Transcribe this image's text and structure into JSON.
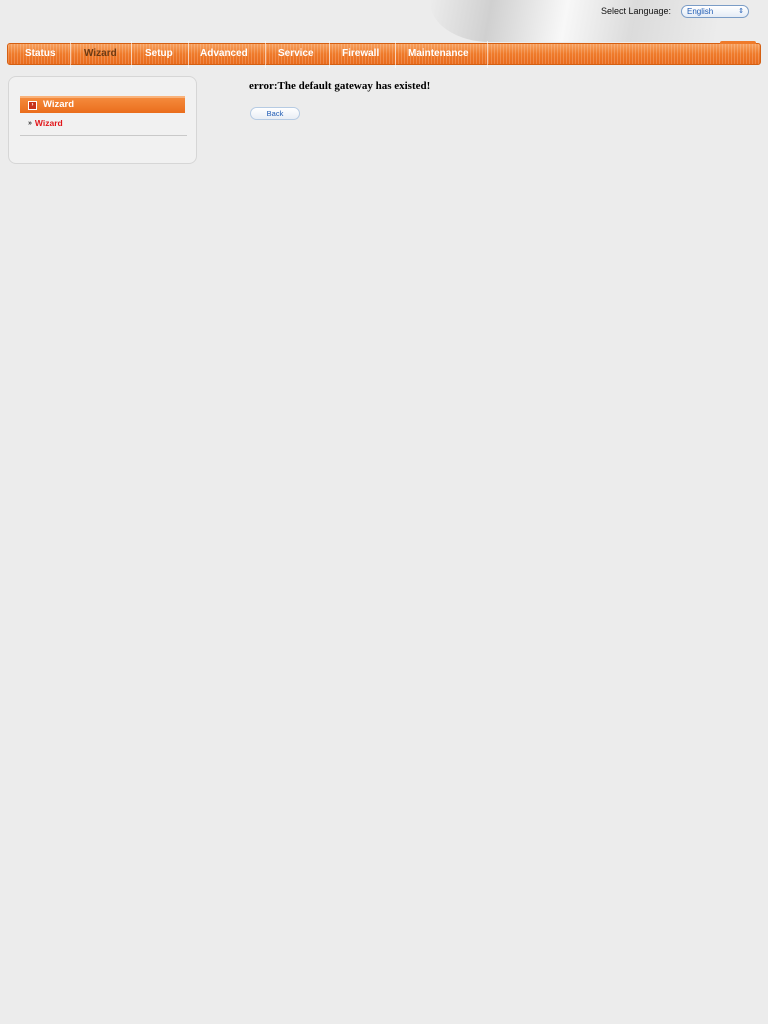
{
  "header": {
    "language_label": "Select Language:",
    "language_value": "English"
  },
  "nav": {
    "items": [
      {
        "label": "Status"
      },
      {
        "label": "Wizard"
      },
      {
        "label": "Setup"
      },
      {
        "label": "Advanced"
      },
      {
        "label": "Service"
      },
      {
        "label": "Firewall"
      },
      {
        "label": "Maintenance"
      }
    ],
    "active": "Wizard"
  },
  "sidebar": {
    "header": "Wizard",
    "items": [
      {
        "label": "Wizard"
      }
    ]
  },
  "main": {
    "error_message": "error:The default gateway has existed!",
    "back_label": "Back"
  },
  "colors": {
    "accent": "#ef7a2a",
    "link_red": "#e2161a",
    "link_blue": "#1d5ab3"
  }
}
